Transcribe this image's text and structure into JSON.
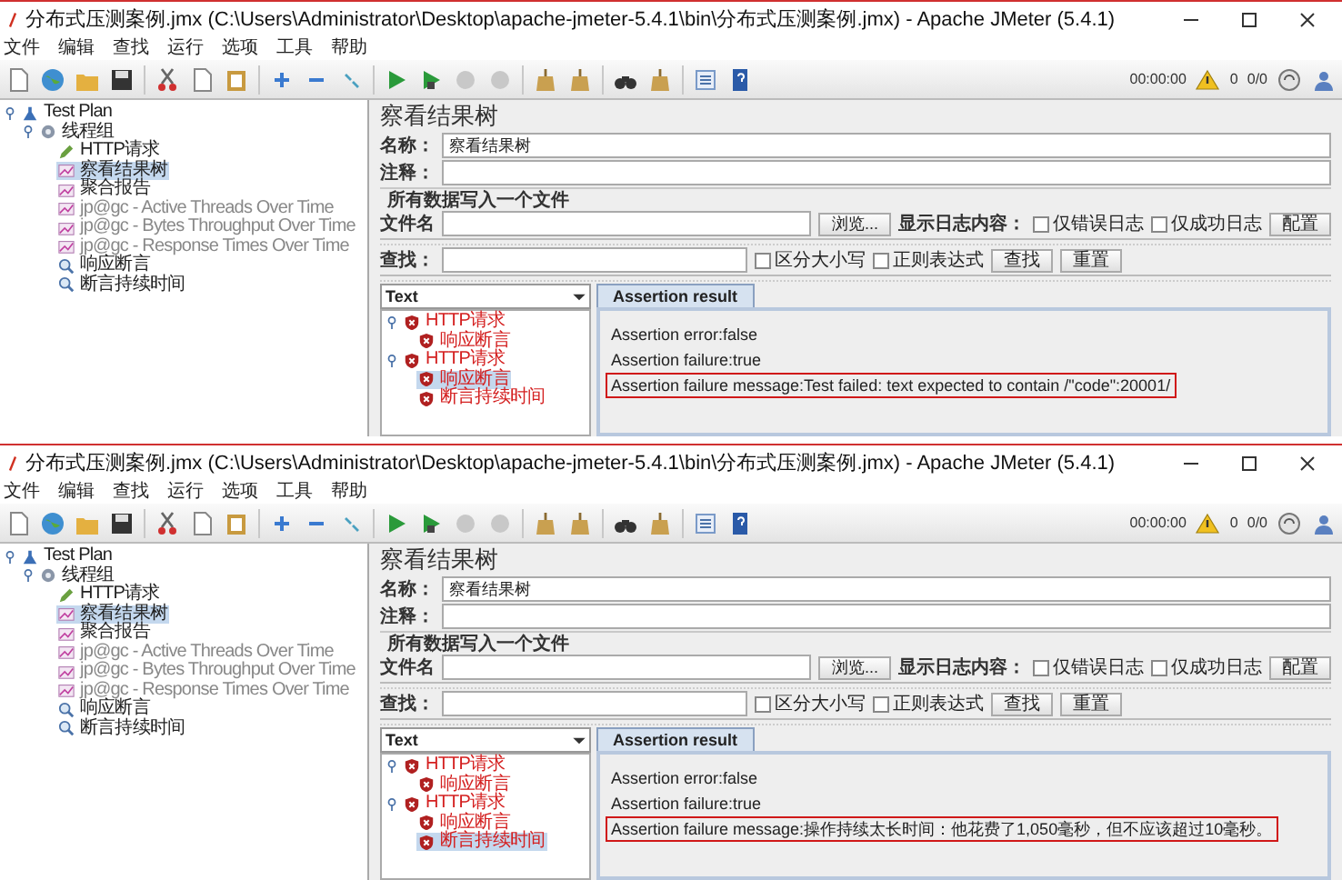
{
  "screenshots": [
    {
      "window": {
        "title": "分布式压测案例.jmx (C:\\Users\\Administrator\\Desktop\\apache-jmeter-5.4.1\\bin\\分布式压测案例.jmx) - Apache JMeter (5.4.1)"
      },
      "menu": [
        "文件",
        "编辑",
        "查找",
        "运行",
        "选项",
        "工具",
        "帮助"
      ],
      "status": {
        "timer": "00:00:00",
        "warnings": "0",
        "threads": "0/0"
      },
      "test_tree": [
        {
          "label": "Test Plan",
          "kind": "plan",
          "selected": false,
          "disabled": false,
          "expanded": true,
          "children": [
            {
              "label": "线程组",
              "kind": "thread_group",
              "selected": false,
              "disabled": false,
              "expanded": true,
              "children": [
                {
                  "label": "HTTP请求",
                  "kind": "sampler",
                  "selected": false,
                  "disabled": false
                },
                {
                  "label": "察看结果树",
                  "kind": "listener",
                  "selected": true,
                  "disabled": false
                },
                {
                  "label": "聚合报告",
                  "kind": "listener",
                  "selected": false,
                  "disabled": false
                },
                {
                  "label": "jp@gc - Active Threads Over Time",
                  "kind": "listener",
                  "selected": false,
                  "disabled": true
                },
                {
                  "label": "jp@gc - Bytes Throughput Over Time",
                  "kind": "listener",
                  "selected": false,
                  "disabled": true
                },
                {
                  "label": "jp@gc - Response Times Over Time",
                  "kind": "listener",
                  "selected": false,
                  "disabled": true
                },
                {
                  "label": "响应断言",
                  "kind": "assertion",
                  "selected": false,
                  "disabled": false
                },
                {
                  "label": "断言持续时间",
                  "kind": "assertion",
                  "selected": false,
                  "disabled": false
                }
              ]
            }
          ]
        }
      ],
      "panel": {
        "title": "察看结果树",
        "name_label": "名称：",
        "name_value": "察看结果树",
        "comment_label": "注释：",
        "file_group": "所有数据写入一个文件",
        "file_label": "文件名",
        "browse": "浏览...",
        "log_label": "显示日志内容：",
        "log_options": [
          {
            "label": "仅错误日志",
            "checked": false
          },
          {
            "label": "仅成功日志",
            "checked": false
          }
        ],
        "configure": "配置",
        "search_label": "查找：",
        "search_options": [
          {
            "label": "区分大小写",
            "checked": false
          },
          {
            "label": "正则表达式",
            "checked": false
          }
        ],
        "find": "查找",
        "reset": "重置",
        "renderer": "Text",
        "result_tree": [
          {
            "label": "HTTP请求",
            "failed": true,
            "selected": false,
            "expanded": true,
            "children": [
              {
                "label": "响应断言",
                "failed": true,
                "selected": false
              }
            ]
          },
          {
            "label": "HTTP请求",
            "failed": true,
            "selected": false,
            "expanded": true,
            "children": [
              {
                "label": "响应断言",
                "failed": true,
                "selected": true
              },
              {
                "label": "断言持续时间",
                "failed": true,
                "selected": false
              }
            ]
          }
        ],
        "tabs": [
          {
            "label": "Assertion result",
            "selected": true
          }
        ],
        "result_lines": [
          {
            "text": "Assertion error:false",
            "highlighted": false
          },
          {
            "text": "Assertion failure:true",
            "highlighted": false
          },
          {
            "text": "Assertion failure message:Test failed: text expected to contain /\"code\":20001/",
            "highlighted": true
          }
        ]
      }
    },
    {
      "window": {
        "title": "分布式压测案例.jmx (C:\\Users\\Administrator\\Desktop\\apache-jmeter-5.4.1\\bin\\分布式压测案例.jmx) - Apache JMeter (5.4.1)"
      },
      "menu": [
        "文件",
        "编辑",
        "查找",
        "运行",
        "选项",
        "工具",
        "帮助"
      ],
      "status": {
        "timer": "00:00:00",
        "warnings": "0",
        "threads": "0/0"
      },
      "test_tree": [
        {
          "label": "Test Plan",
          "kind": "plan",
          "selected": false,
          "disabled": false,
          "expanded": true,
          "children": [
            {
              "label": "线程组",
              "kind": "thread_group",
              "selected": false,
              "disabled": false,
              "expanded": true,
              "children": [
                {
                  "label": "HTTP请求",
                  "kind": "sampler",
                  "selected": false,
                  "disabled": false
                },
                {
                  "label": "察看结果树",
                  "kind": "listener",
                  "selected": true,
                  "disabled": false
                },
                {
                  "label": "聚合报告",
                  "kind": "listener",
                  "selected": false,
                  "disabled": false
                },
                {
                  "label": "jp@gc - Active Threads Over Time",
                  "kind": "listener",
                  "selected": false,
                  "disabled": true
                },
                {
                  "label": "jp@gc - Bytes Throughput Over Time",
                  "kind": "listener",
                  "selected": false,
                  "disabled": true
                },
                {
                  "label": "jp@gc - Response Times Over Time",
                  "kind": "listener",
                  "selected": false,
                  "disabled": true
                },
                {
                  "label": "响应断言",
                  "kind": "assertion",
                  "selected": false,
                  "disabled": false
                },
                {
                  "label": "断言持续时间",
                  "kind": "assertion",
                  "selected": false,
                  "disabled": false
                }
              ]
            }
          ]
        }
      ],
      "panel": {
        "title": "察看结果树",
        "name_label": "名称：",
        "name_value": "察看结果树",
        "comment_label": "注释：",
        "file_group": "所有数据写入一个文件",
        "file_label": "文件名",
        "browse": "浏览...",
        "log_label": "显示日志内容：",
        "log_options": [
          {
            "label": "仅错误日志",
            "checked": false
          },
          {
            "label": "仅成功日志",
            "checked": false
          }
        ],
        "configure": "配置",
        "search_label": "查找：",
        "search_options": [
          {
            "label": "区分大小写",
            "checked": false
          },
          {
            "label": "正则表达式",
            "checked": false
          }
        ],
        "find": "查找",
        "reset": "重置",
        "renderer": "Text",
        "result_tree": [
          {
            "label": "HTTP请求",
            "failed": true,
            "selected": false,
            "expanded": true,
            "children": [
              {
                "label": "响应断言",
                "failed": true,
                "selected": false
              }
            ]
          },
          {
            "label": "HTTP请求",
            "failed": true,
            "selected": false,
            "expanded": true,
            "children": [
              {
                "label": "响应断言",
                "failed": true,
                "selected": false
              },
              {
                "label": "断言持续时间",
                "failed": true,
                "selected": true
              }
            ]
          }
        ],
        "tabs": [
          {
            "label": "Assertion result",
            "selected": true
          }
        ],
        "result_lines": [
          {
            "text": "Assertion error:false",
            "highlighted": false
          },
          {
            "text": "Assertion failure:true",
            "highlighted": false
          },
          {
            "text": "Assertion failure message:操作持续太长时间：他花费了1,050毫秒，但不应该超过10毫秒。",
            "highlighted": true
          }
        ]
      }
    }
  ]
}
